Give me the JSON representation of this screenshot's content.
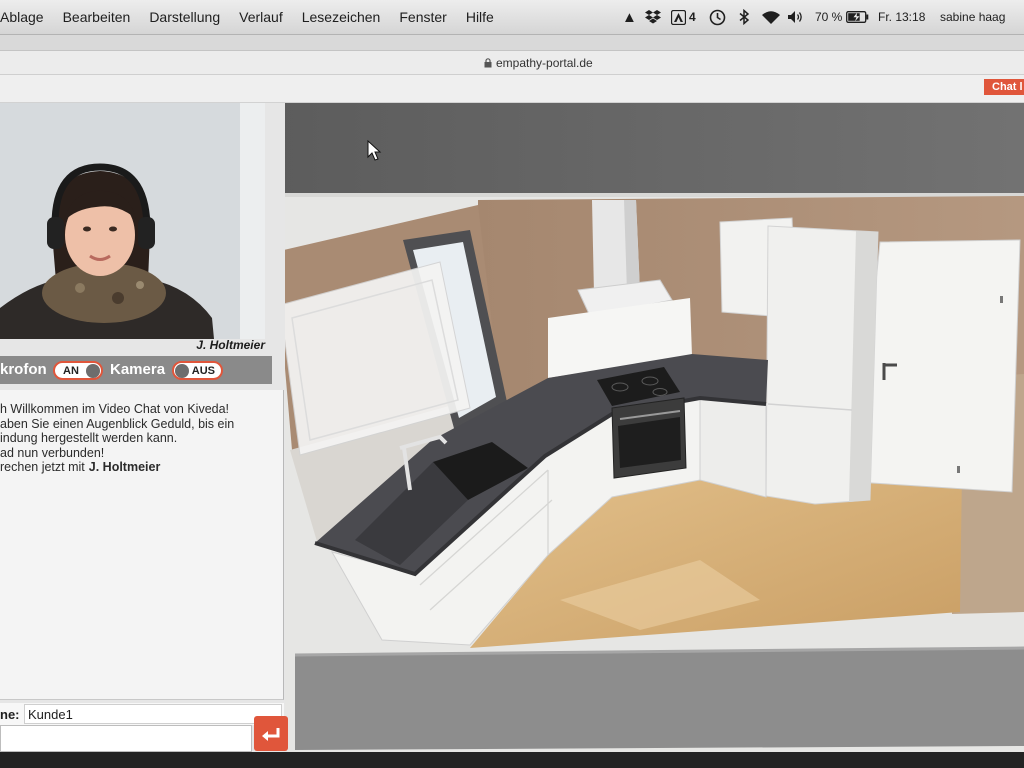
{
  "menubar": {
    "items": [
      "Ablage",
      "Bearbeiten",
      "Darstellung",
      "Verlauf",
      "Lesezeichen",
      "Fenster",
      "Hilfe"
    ],
    "adobe_badge": "4",
    "battery_percent": "70 %",
    "clock": "Fr. 13:18",
    "user": "sabine haag",
    "icons": [
      "triangle-icon",
      "dropbox-icon",
      "adobe-cc-icon",
      "time-machine-icon",
      "bluetooth-icon",
      "wifi-icon",
      "volume-icon",
      "battery-icon"
    ]
  },
  "browser": {
    "url": "empathy-portal.de",
    "url_icon": "lock-icon",
    "chat_button_label": "Chat l"
  },
  "video": {
    "participant_name": "J. Holtmeier"
  },
  "controls": {
    "microphone_label": "krofon",
    "microphone_state": "AN",
    "camera_label": "Kamera",
    "camera_state": "AUS"
  },
  "chat": {
    "lines": [
      "h Willkommen im Video Chat von Kiveda!",
      "aben Sie einen Augenblick Geduld, bis ein",
      "indung hergestellt werden kann.",
      "ad nun verbunden!"
    ],
    "connected_prefix": "rechen jetzt mit",
    "connected_name": "J. Holtmeier"
  },
  "name_field": {
    "label": "ne:",
    "value": "Kunde1"
  },
  "send_icon": "return-arrow-icon",
  "colors": {
    "accent": "#e0563b",
    "control_bar": "#8a8a8a",
    "viewport_top": "#666666"
  }
}
